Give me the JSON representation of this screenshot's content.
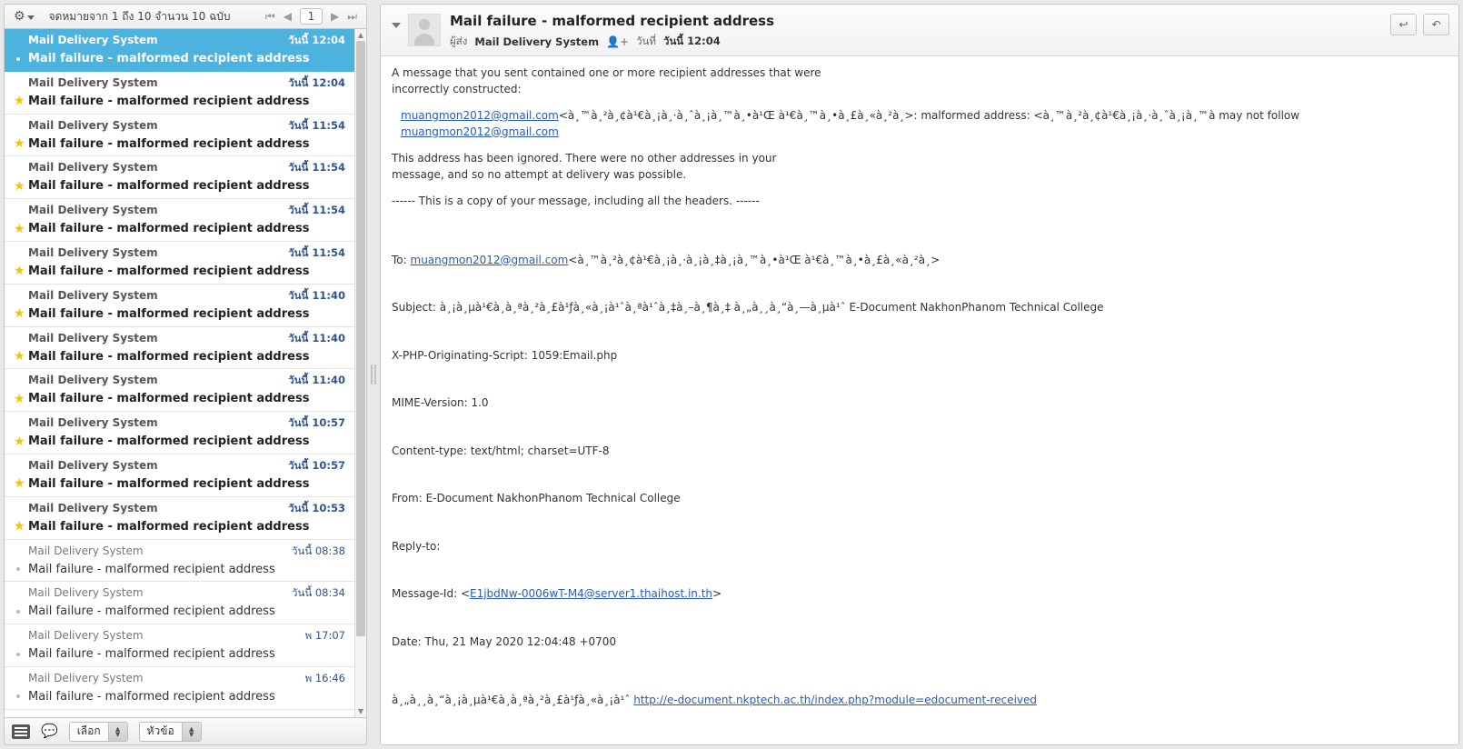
{
  "list_header": {
    "gear_icon": "gear-icon",
    "count_text": "จดหมายจาก 1 ถึง 10 จำนวน 10 ฉบับ",
    "pager": {
      "first": "⏮",
      "prev": "◀",
      "page": "1",
      "next": "▶",
      "last": "⏭"
    }
  },
  "messages": [
    {
      "from": "Mail Delivery System",
      "date": "วันนี้ 12:04",
      "subject": "Mail failure - malformed recipient address",
      "state": "selected",
      "mark": "dot",
      "flag": false
    },
    {
      "from": "Mail Delivery System",
      "date": "วันนี้ 12:04",
      "subject": "Mail failure - malformed recipient address",
      "state": "unread",
      "mark": "star",
      "flag": false
    },
    {
      "from": "Mail Delivery System",
      "date": "วันนี้ 11:54",
      "subject": "Mail failure - malformed recipient address",
      "state": "unread",
      "mark": "star",
      "flag": false
    },
    {
      "from": "Mail Delivery System",
      "date": "วันนี้ 11:54",
      "subject": "Mail failure - malformed recipient address",
      "state": "unread",
      "mark": "star",
      "flag": false
    },
    {
      "from": "Mail Delivery System",
      "date": "วันนี้ 11:54",
      "subject": "Mail failure - malformed recipient address",
      "state": "unread",
      "mark": "star",
      "flag": false
    },
    {
      "from": "Mail Delivery System",
      "date": "วันนี้ 11:54",
      "subject": "Mail failure - malformed recipient address",
      "state": "unread",
      "mark": "star",
      "flag": false
    },
    {
      "from": "Mail Delivery System",
      "date": "วันนี้ 11:40",
      "subject": "Mail failure - malformed recipient address",
      "state": "unread",
      "mark": "star",
      "flag": false
    },
    {
      "from": "Mail Delivery System",
      "date": "วันนี้ 11:40",
      "subject": "Mail failure - malformed recipient address",
      "state": "unread",
      "mark": "star",
      "flag": false
    },
    {
      "from": "Mail Delivery System",
      "date": "วันนี้ 11:40",
      "subject": "Mail failure - malformed recipient address",
      "state": "unread",
      "mark": "star",
      "flag": false
    },
    {
      "from": "Mail Delivery System",
      "date": "วันนี้ 10:57",
      "subject": "Mail failure - malformed recipient address",
      "state": "unread",
      "mark": "star",
      "flag": false
    },
    {
      "from": "Mail Delivery System",
      "date": "วันนี้ 10:57",
      "subject": "Mail failure - malformed recipient address",
      "state": "unread",
      "mark": "star",
      "flag": true
    },
    {
      "from": "Mail Delivery System",
      "date": "วันนี้ 10:53",
      "subject": "Mail failure - malformed recipient address",
      "state": "unread",
      "mark": "star",
      "flag": false
    },
    {
      "from": "Mail Delivery System",
      "date": "วันนี้ 08:38",
      "subject": "Mail failure - malformed recipient address",
      "state": "read",
      "mark": "dot",
      "flag": false
    },
    {
      "from": "Mail Delivery System",
      "date": "วันนี้ 08:34",
      "subject": "Mail failure - malformed recipient address",
      "state": "read",
      "mark": "dot",
      "flag": false
    },
    {
      "from": "Mail Delivery System",
      "date": "พ 17:07",
      "subject": "Mail failure - malformed recipient address",
      "state": "read",
      "mark": "dot",
      "flag": false
    },
    {
      "from": "Mail Delivery System",
      "date": "พ 16:46",
      "subject": "Mail failure - malformed recipient address",
      "state": "read",
      "mark": "dot",
      "flag": false
    }
  ],
  "list_footer": {
    "listview_icon": "list-view-icon",
    "threads_icon": "threads-icon",
    "select_label": "เลือก",
    "sort_label": "หัวข้อ"
  },
  "message": {
    "subject": "Mail failure - malformed recipient address",
    "sender_label": "ผู้ส่ง",
    "sender": "Mail Delivery System",
    "add_contact_icon": "add-contact-icon",
    "date_label": "วันที่",
    "date": "วันนี้ 12:04",
    "reply_icon": "reply-icon",
    "reply_all_icon": "reply-all-icon",
    "intro": "A message that you sent contained one or more recipient addresses that were\nincorrectly constructed:",
    "bad_address_prefix": "",
    "bad_address_email": "muangmon2012@gmail.com",
    "bad_address_mid": "<à¸™à¸²à¸¢à¹€à¸¡à¸·à¸ˆà¸¡à¸™à¸•à¹Œ à¹€à¸™à¸•à¸£à¸«à¸²à¸>: malformed address: <à¸™à¸²à¸¢à¹€à¸¡à¸·à¸ˆà¸¡à¸™à may not follow ",
    "bad_address_email2": "muangmon2012@gmail.com",
    "ignored_note": "This address has been ignored. There were no other addresses in your\nmessage, and so no attempt at delivery was possible.",
    "copy_divider": "------ This is a copy of your message, including all the headers. ------",
    "headers": {
      "to_label": "To: ",
      "to_email": "muangmon2012@gmail.com",
      "to_rest": "<à¸™à¸²à¸¢à¹€à¸¡à¸·à¸¡à¸‡à¸¡à¸™à¸•à¹Œ à¹€à¸™à¸•à¸£à¸«à¸²à¸>",
      "subject": "Subject: à¸¡à¸µà¹€à¸­à¸ªà¸²à¸£à¹ƒà¸«à¸¡à¹ˆà¸ªà¹ˆà¸‡à¸–à¸¶à¸‡ à¸„à¸¸à¸“à¸—à¸µà¹ˆ E-Document NakhonPhanom Technical College",
      "xphp": "X-PHP-Originating-Script: 1059:Email.php",
      "mime": "MIME-Version: 1.0",
      "content_type": "Content-type: text/html; charset=UTF-8",
      "from": "From: E-Document NakhonPhanom Technical College",
      "reply_to": "Reply-to:",
      "message_id_label": "Message-Id: <",
      "message_id": "E1jbdNw-0006wT-M4@server1.thaihost.in.th",
      "message_id_close": ">",
      "date": "Date: Thu, 21 May 2020 12:04:48 +0700"
    },
    "footer_thai": "à¸„à¸¸à¸“à¸¡à¸µà¹€à¸­à¸ªà¸²à¸£à¹ƒà¸«à¸¡à¹ˆ ",
    "footer_link": "http://e-document.nkptech.ac.th/index.php?module=edocument-received"
  },
  "colors": {
    "selection": "#4db2dd",
    "star": "#f4c400",
    "link": "#2a5db0",
    "date": "#30558c"
  }
}
